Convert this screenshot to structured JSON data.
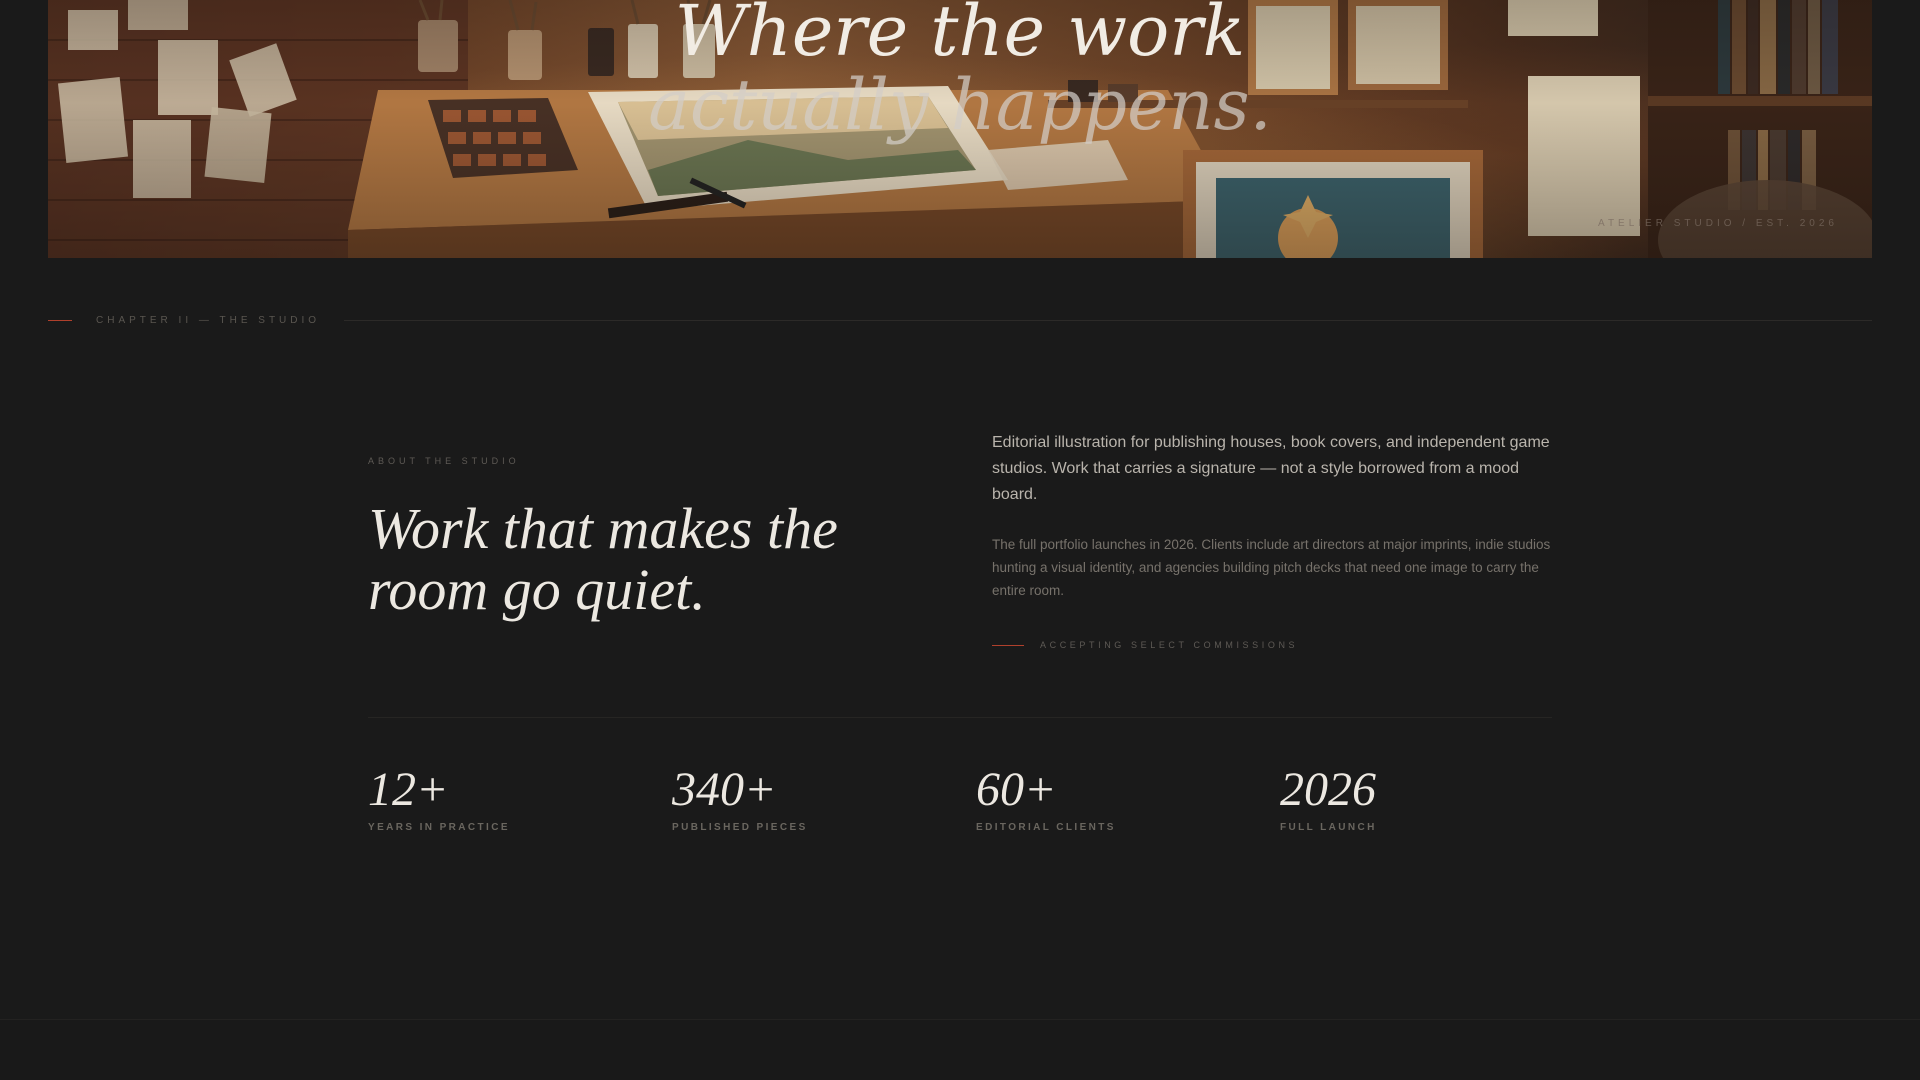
{
  "hero": {
    "title_line1": "Where the work",
    "title_line2": "actually happens.",
    "caption": "ATELIER STUDIO / EST. 2026"
  },
  "chapter": {
    "label": "CHAPTER II — THE STUDIO"
  },
  "about": {
    "eyebrow": "ABOUT THE STUDIO",
    "headline": "Work that makes the room go quiet.",
    "lead": "Editorial illustration for publishing houses, book covers, and independent game studios. Work that carries a signature — not a style borrowed from a mood board.",
    "body": "The full portfolio launches in 2026. Clients include art directors at major imprints, indie studios hunting a visual identity, and agencies building pitch decks that need one image to carry the entire room.",
    "commission": "ACCEPTING SELECT COMMISSIONS"
  },
  "stats": [
    {
      "value": "12+",
      "label": "YEARS IN PRACTICE"
    },
    {
      "value": "340+",
      "label": "PUBLISHED PIECES"
    },
    {
      "value": "60+",
      "label": "EDITORIAL CLIENTS"
    },
    {
      "value": "2026",
      "label": "FULL LAUNCH"
    }
  ],
  "colors": {
    "background": "#1a1a1a",
    "accent": "#b0402c",
    "text_primary": "#ece8e1",
    "text_muted": "#5e5a55"
  }
}
